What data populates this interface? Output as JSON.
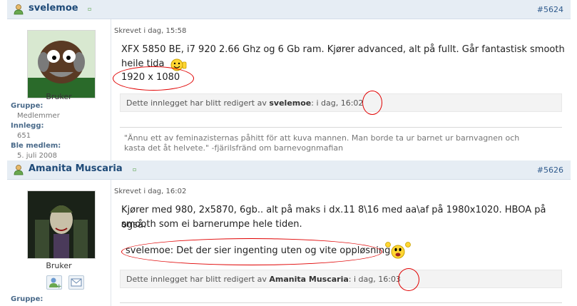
{
  "posts": [
    {
      "username": "svelemoe",
      "post_number": "#5624",
      "rank": "Bruker",
      "group_label": "Gruppe:",
      "group_value": "Medlemmer",
      "posts_label": "Innlegg:",
      "posts_value": "651",
      "member_since_label": "Ble medlem:",
      "member_since_value": "5. juli 2008",
      "posted": "Skrevet i dag, 15:58",
      "body_line1": "XFX 5850 BE, i7 920 2.66 Ghz og 6 Gb ram. Kjører advanced, alt på fullt. Går fantastisk smooth",
      "body_line2": "heile tida",
      "resolution": "1920 x 1080",
      "edited_prefix": "Dette innlegget har blitt redigert av",
      "edited_user": "svelemoe",
      "edited_suffix": ": i dag, 16:02",
      "signature_line1": "\"Ännu ett av feminazisternas påhitt för att kuva mannen. Man borde ta ur barnet ur barnvagnen och",
      "signature_line2": "kasta det åt helvete.\" -fjärilsfränd om barnevognmafian"
    },
    {
      "username": "Amanita Muscaria",
      "post_number": "#5626",
      "rank": "Bruker",
      "group_label": "Gruppe:",
      "posted": "Skrevet i dag, 16:02",
      "body_line1": "Kjører med 980, 2x5870, 6gb.. alt på maks i dx.11 8\\16 med aa\\af på 1980x1020. HBOA på også.",
      "body_line2": "smooth som ei barnerumpe hele tiden.",
      "body_line3": "svelemoe: Det der sier ingenting uten og vite oppløsning",
      "edited_prefix": "Dette innlegget har blitt redigert av",
      "edited_user": "Amanita Muscaria",
      "edited_suffix": ": i dag, 16:03"
    }
  ],
  "icons": [
    "user-icon",
    "online-status-icon",
    "smiley-thumbs-up-icon",
    "smiley-cheer-icon",
    "add-contact-icon",
    "send-message-icon"
  ],
  "colors": {
    "header_bg": "#e6edf4",
    "username": "#1e4a78",
    "annotation_red": "#e00000"
  }
}
